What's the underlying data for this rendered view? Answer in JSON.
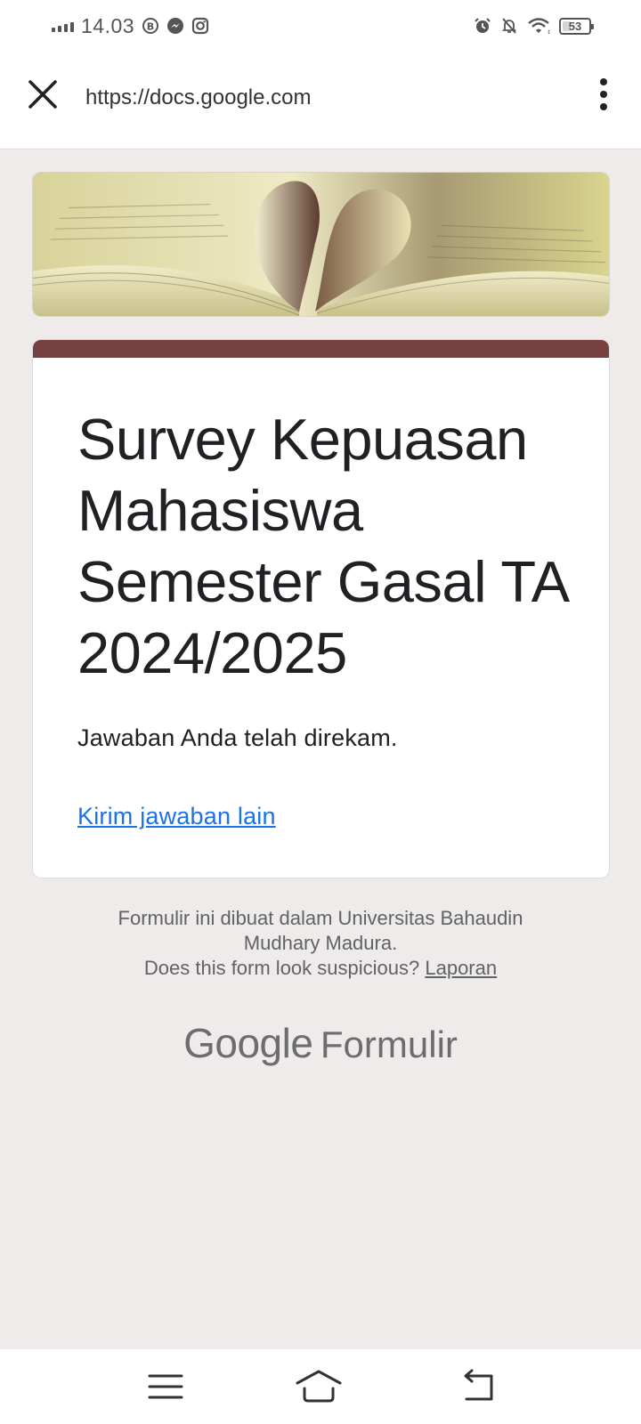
{
  "status_bar": {
    "time": "14.03",
    "battery": "53",
    "icons": [
      "signal-icon",
      "b-icon",
      "messenger-icon",
      "instagram-icon",
      "alarm-icon",
      "mute-icon",
      "wifi-icon",
      "battery-icon"
    ]
  },
  "browser": {
    "url": "https://docs.google.com",
    "close_icon": "close-icon",
    "menu_icon": "more-vert-icon"
  },
  "form": {
    "title": "Survey Kepuasan Mahasiswa Semester Gasal TA 2024/2025",
    "confirmation": "Jawaban Anda telah direkam.",
    "resubmit_link": "Kirim jawaban lain",
    "accent_color": "#77413f",
    "link_color": "#1a73e8"
  },
  "footer": {
    "line1": "Formulir ini dibuat dalam Universitas Bahaudin",
    "line2": "Mudhary Madura.",
    "suspicious_text": "Does this form look suspicious?",
    "report_link": "Laporan"
  },
  "brand": {
    "google": "Google",
    "product": "Formulir"
  },
  "nav_bar": {
    "icons": [
      "menu-icon",
      "home-icon",
      "back-icon"
    ]
  }
}
